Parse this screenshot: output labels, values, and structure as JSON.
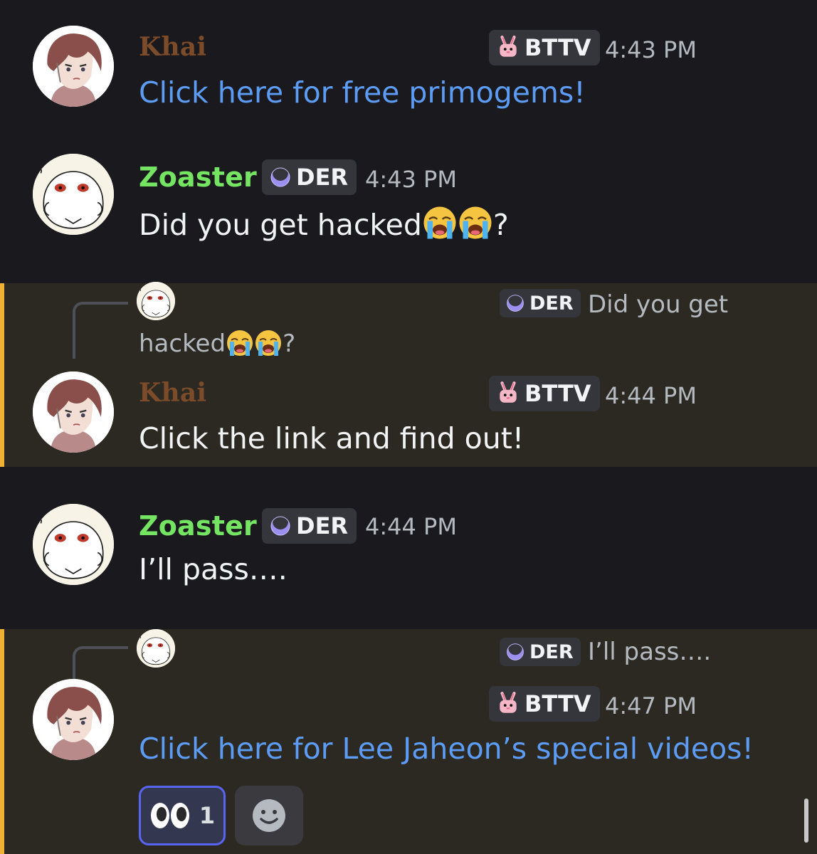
{
  "messages": [
    {
      "author": "Khai",
      "tag": "BTTV",
      "time": "4:43 PM",
      "text": "Click here for free primogems!"
    },
    {
      "author": "Zoaster",
      "tag": "DER",
      "time": "4:43 PM",
      "text": "Did you get hacked",
      "text_end": "?"
    },
    {
      "reply_tag": "DER",
      "reply_text_line1": "Did you get",
      "reply_text_line2": "hacked",
      "reply_text_end": "?",
      "author": "Khai",
      "tag": "BTTV",
      "time": "4:44 PM",
      "text": "Click the link and find out!"
    },
    {
      "author": "Zoaster",
      "tag": "DER",
      "time": "4:44 PM",
      "text": "I’ll pass…."
    },
    {
      "reply_tag": "DER",
      "reply_text": "I’ll pass….",
      "tag": "BTTV",
      "time": "4:47 PM",
      "text": "Click here for Lee Jaheon’s special videos!",
      "reaction_count": "1"
    }
  ],
  "icons": {
    "bttv": "bunny-icon",
    "der": "crescent-moon-icon",
    "crying": "loudly-crying-face-emoji",
    "eyes": "eyes-emoji",
    "add_reaction": "add-reaction-icon"
  },
  "colors": {
    "khai_name": "#7b4b2a",
    "zoaster_name": "#74e462",
    "link": "#5c9cf5",
    "mention_bar": "#f0b232",
    "mention_bg": "#2c2922",
    "reaction_border": "#5865f2"
  }
}
